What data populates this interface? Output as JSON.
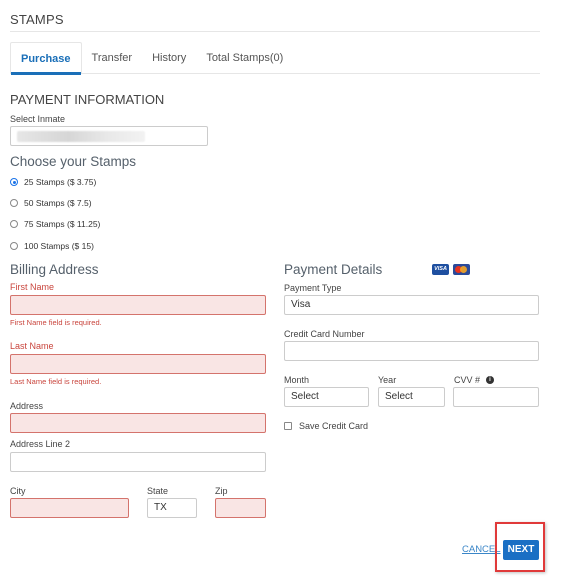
{
  "page": {
    "title": "STAMPS"
  },
  "tabs": [
    {
      "label": "Purchase",
      "active": true
    },
    {
      "label": "Transfer",
      "active": false
    },
    {
      "label": "History",
      "active": false
    },
    {
      "label": "Total Stamps(0)",
      "active": false
    }
  ],
  "payment_information": {
    "heading": "PAYMENT INFORMATION",
    "select_inmate_label": "Select Inmate",
    "select_inmate_value": ""
  },
  "stamps": {
    "heading": "Choose your Stamps",
    "options": [
      {
        "label": "25 Stamps ($ 3.75)",
        "selected": true
      },
      {
        "label": "50 Stamps ($ 7.5)",
        "selected": false
      },
      {
        "label": "75 Stamps ($ 11.25)",
        "selected": false
      },
      {
        "label": "100 Stamps ($ 15)",
        "selected": false
      }
    ]
  },
  "billing": {
    "heading": "Billing Address",
    "first_name_label": "First Name",
    "first_name_value": "",
    "first_name_error": "First Name field is required.",
    "last_name_label": "Last Name",
    "last_name_value": "",
    "last_name_error": "Last Name field is required.",
    "address_label": "Address",
    "address_value": "",
    "address2_label": "Address Line 2",
    "address2_value": "",
    "city_label": "City",
    "city_value": "",
    "state_label": "State",
    "state_value": "TX",
    "zip_label": "Zip",
    "zip_value": ""
  },
  "payment_details": {
    "heading": "Payment Details",
    "card_icons": [
      "visa-icon",
      "mastercard-icon"
    ],
    "visa_text": "VISA",
    "payment_type_label": "Payment Type",
    "payment_type_value": "Visa",
    "cc_number_label": "Credit Card Number",
    "cc_number_value": "",
    "month_label": "Month",
    "month_value": "Select",
    "year_label": "Year",
    "year_value": "Select",
    "cvv_label": "CVV #",
    "cvv_info_icon": "i",
    "cvv_value": "",
    "save_card_label": "Save Credit Card",
    "save_card_checked": false
  },
  "actions": {
    "cancel_label": "CANCEL",
    "next_label": "NEXT"
  },
  "colors": {
    "accent": "#1a6fb8",
    "error": "#c9453d",
    "error_bg": "#f9e5e4",
    "highlight": "#e03a3a"
  }
}
